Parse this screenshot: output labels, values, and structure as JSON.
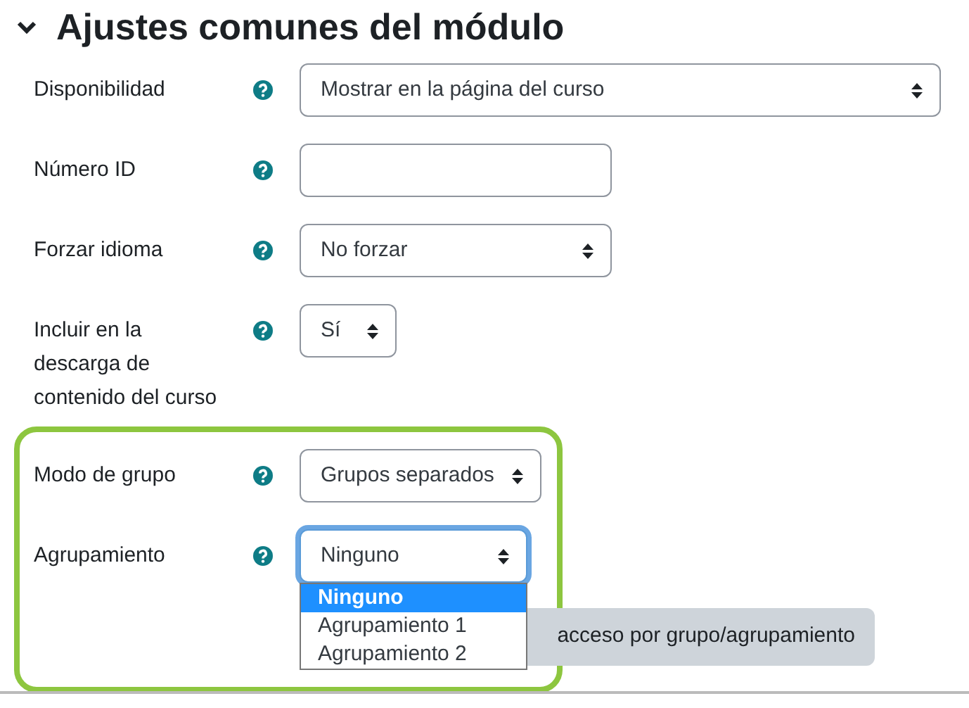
{
  "section": {
    "title": "Ajustes comunes del módulo",
    "expanded": true
  },
  "fields": [
    {
      "label": "Disponibilidad",
      "kind": "select",
      "value": "Mostrar en la página del curso"
    },
    {
      "label": "Número ID",
      "kind": "input"
    },
    {
      "label": "Forzar idioma",
      "kind": "select",
      "value": "No forzar"
    },
    {
      "label": "Incluir en la descarga de contenido del curso",
      "kind": "select",
      "value": "Sí"
    }
  ],
  "highlighted": {
    "fields": [
      {
        "label": "Modo de grupo",
        "kind": "select",
        "value": "Grupos separados",
        "focused": false
      },
      {
        "label": "Agrupamiento",
        "kind": "select",
        "value": "Ninguno",
        "focused": true
      }
    ],
    "open_menu": {
      "options": [
        {
          "label": "Ninguno",
          "selected": true
        },
        {
          "label": "Agrupamiento 1",
          "selected": false
        },
        {
          "label": "Agrupamiento 2",
          "selected": false
        }
      ]
    },
    "button": {
      "label": "acceso por grupo/agrupamiento"
    }
  }
}
